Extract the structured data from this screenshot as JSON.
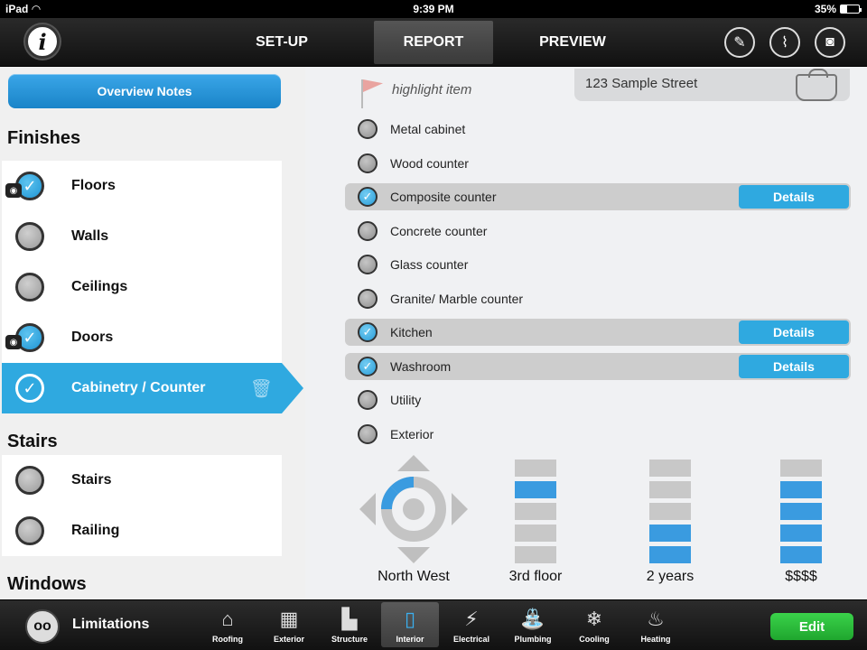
{
  "status_bar": {
    "device": "iPad",
    "time": "9:39 PM",
    "battery_text": "35%",
    "battery_level": 0.35
  },
  "top_nav": {
    "tabs": [
      {
        "label": "SET-UP",
        "active": false
      },
      {
        "label": "REPORT",
        "active": true
      },
      {
        "label": "PREVIEW",
        "active": false
      }
    ],
    "info_icon": "info-icon",
    "tools": [
      "marker-icon",
      "paperclip-icon",
      "camera-icon"
    ]
  },
  "sidebar": {
    "overview_button": "Overview Notes",
    "sections": [
      {
        "title": "Finishes",
        "items": [
          {
            "label": "Floors",
            "checked": true,
            "has_photo": true
          },
          {
            "label": "Walls",
            "checked": false,
            "has_photo": false
          },
          {
            "label": "Ceilings",
            "checked": false,
            "has_photo": false
          },
          {
            "label": "Doors",
            "checked": true,
            "has_photo": true
          },
          {
            "label": "Cabinetry / Counter",
            "checked": true,
            "has_photo": false,
            "selected": true
          }
        ]
      },
      {
        "title": "Stairs",
        "items": [
          {
            "label": "Stairs",
            "checked": false
          },
          {
            "label": "Railing",
            "checked": false
          }
        ]
      },
      {
        "title": "Windows",
        "items": []
      }
    ]
  },
  "main": {
    "highlight_label": "highlight item",
    "address": "123 Sample Street",
    "details_label": "Details",
    "options": [
      {
        "label": "Metal cabinet",
        "checked": false
      },
      {
        "label": "Wood counter",
        "checked": false
      },
      {
        "label": "Composite counter",
        "checked": true
      },
      {
        "label": "Concrete counter",
        "checked": false
      },
      {
        "label": "Glass counter",
        "checked": false
      },
      {
        "label": "Granite/ Marble counter",
        "checked": false
      },
      {
        "label": "Kitchen",
        "checked": true
      },
      {
        "label": "Washroom",
        "checked": true
      },
      {
        "label": "Utility",
        "checked": false
      },
      {
        "label": "Exterior",
        "checked": false
      }
    ],
    "indicators": {
      "direction": "North West",
      "floor": {
        "label": "3rd floor",
        "segments": 5,
        "active": [
          1
        ]
      },
      "age": {
        "label": "2 years",
        "segments": 5,
        "active": [
          3,
          4
        ]
      },
      "cost": {
        "label": "$$$$",
        "segments": 5,
        "active": [
          1,
          2,
          3,
          4
        ]
      }
    }
  },
  "bottom_bar": {
    "limitations_label": "Limitations",
    "tabs": [
      {
        "label": "Roofing",
        "icon": "roof-icon"
      },
      {
        "label": "Exterior",
        "icon": "brick-icon"
      },
      {
        "label": "Structure",
        "icon": "structure-icon"
      },
      {
        "label": "Interior",
        "icon": "door-icon",
        "active": true
      },
      {
        "label": "Electrical",
        "icon": "bulb-icon"
      },
      {
        "label": "Plumbing",
        "icon": "faucet-icon"
      },
      {
        "label": "Cooling",
        "icon": "cooling-icon"
      },
      {
        "label": "Heating",
        "icon": "heating-icon"
      }
    ],
    "edit_label": "Edit"
  }
}
